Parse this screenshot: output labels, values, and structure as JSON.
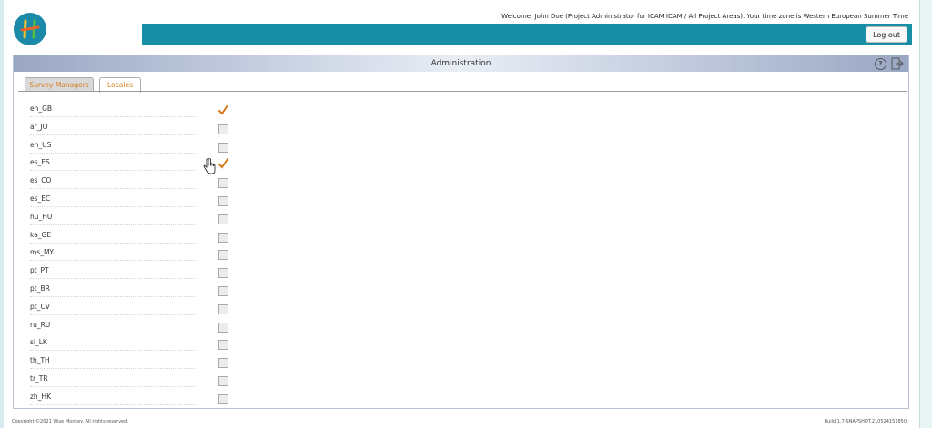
{
  "header": {
    "welcome_text": "Welcome, John Doe (Project Administrator for ICAM ICAM / All Project Areas). Your time zone is Western European Summer Time",
    "logout_label": "Log out"
  },
  "panel": {
    "title": "Administration"
  },
  "tabs": [
    {
      "label": "Survey Managers",
      "active": false
    },
    {
      "label": "Locales",
      "active": true
    }
  ],
  "locales": [
    {
      "code": "en_GB",
      "checked": true
    },
    {
      "code": "ar_JO",
      "checked": false
    },
    {
      "code": "en_US",
      "checked": false
    },
    {
      "code": "es_ES",
      "checked": true
    },
    {
      "code": "es_CO",
      "checked": false
    },
    {
      "code": "es_EC",
      "checked": false
    },
    {
      "code": "hu_HU",
      "checked": false
    },
    {
      "code": "ka_GE",
      "checked": false
    },
    {
      "code": "ms_MY",
      "checked": false
    },
    {
      "code": "pt_PT",
      "checked": false
    },
    {
      "code": "pt_BR",
      "checked": false
    },
    {
      "code": "pt_CV",
      "checked": false
    },
    {
      "code": "ru_RU",
      "checked": false
    },
    {
      "code": "si_LK",
      "checked": false
    },
    {
      "code": "th_TH",
      "checked": false
    },
    {
      "code": "tr_TR",
      "checked": false
    },
    {
      "code": "zh_HK",
      "checked": false
    }
  ],
  "footer": {
    "copyright": "Copyright ©2021 Wise Monkey. All rights reserved.",
    "build": "Build 1.7-SNAPSHOT.210524151850"
  },
  "colors": {
    "topbar": "#178fa5",
    "accent_orange": "#d77a1a",
    "logo_bg": "#1a8aa8"
  },
  "icons": {
    "logo": "logo-icon",
    "help": "help-icon",
    "exit": "exit-icon",
    "checkmark": "checkmark-icon",
    "cursor": "hand-cursor-icon"
  }
}
